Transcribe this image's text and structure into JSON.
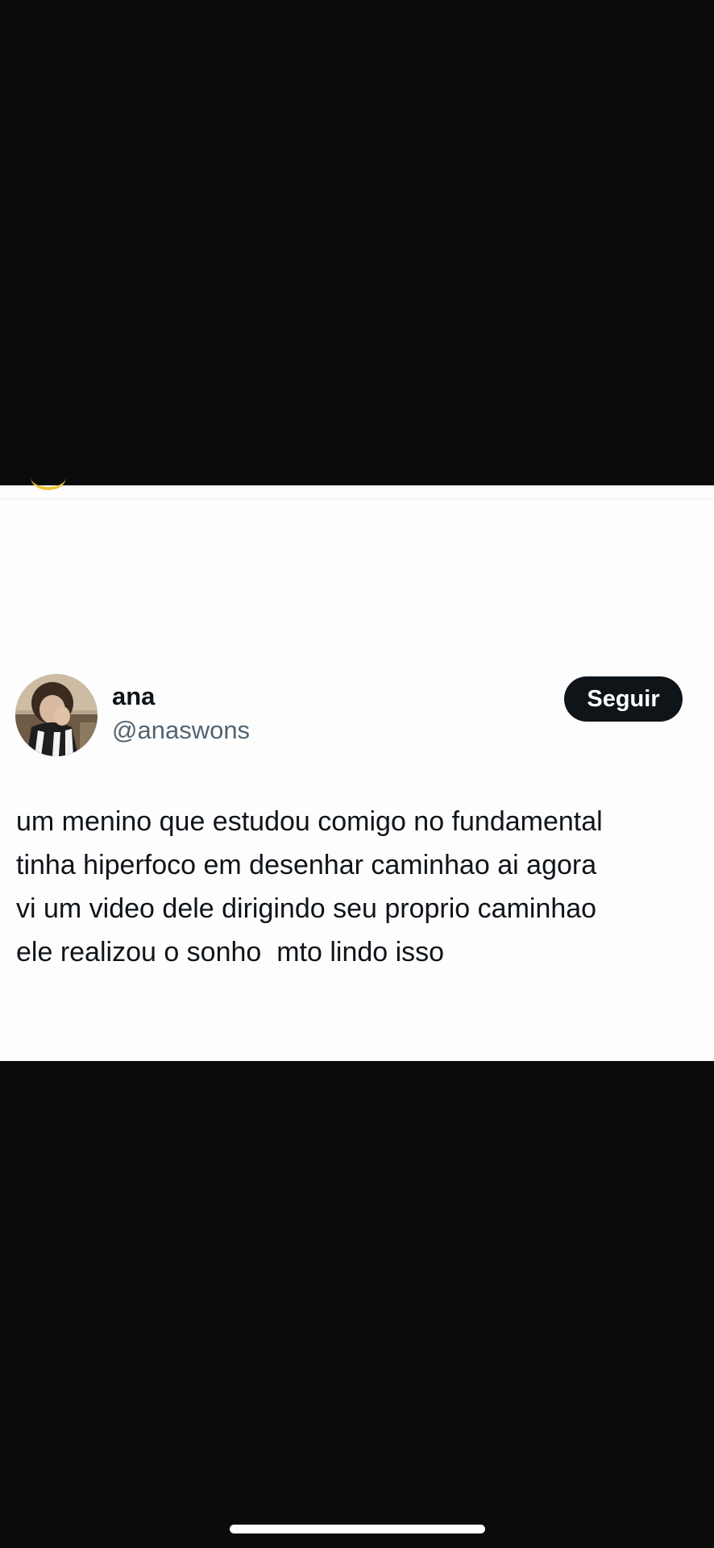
{
  "tweet": {
    "author": {
      "display_name": "ana",
      "handle": "@anaswons",
      "avatar_icon": "profile-photo"
    },
    "follow_button": {
      "label": "Seguir"
    },
    "text_lines": [
      "um menino que estudou comigo no fundamental",
      "tinha hiperfoco em desenhar caminhao ai agora",
      "vi um video dele dirigindo seu proprio caminhao",
      "ele realizou o sonho  mto lindo isso"
    ]
  },
  "colors": {
    "background": "#0b0b0b",
    "card": "#fdfdfd",
    "text_primary": "#0f1419",
    "text_secondary": "#536471",
    "button_bg": "#0f1419",
    "button_text": "#ffffff",
    "accent_arc": "#f0c23a"
  }
}
